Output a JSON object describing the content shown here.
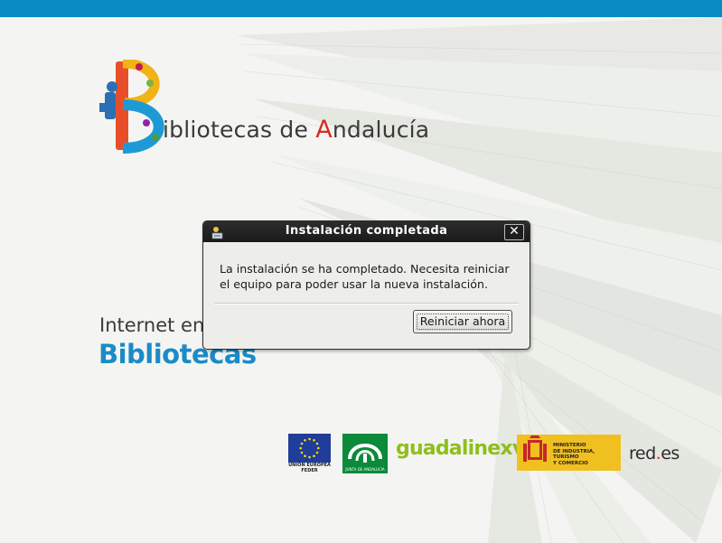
{
  "brand": {
    "logo_text_initial": "B",
    "logo_text_rest": "ibliotecas de ",
    "logo_text_a": "A",
    "logo_text_end": "ndalucía",
    "internet_line1": "Internet en",
    "internet_line2": "Bibliotecas"
  },
  "dialog": {
    "title": "Instalación completada",
    "close_label": "✕",
    "message": "La instalación se ha completado. Necesita reiniciar el equipo para poder usar la nueva instalación.",
    "reboot_label": "Reiniciar ahora"
  },
  "footer": {
    "eu_text": "UNIÓN EUROPEA FEDER",
    "junta_text": "JUNTA DE ANDALUCIA",
    "guadalinex_text": "guadalinex",
    "guadalinex_version": "v5",
    "ministerio_line1": "MINISTERIO",
    "ministerio_line2": "DE INDUSTRIA, TURISMO",
    "ministerio_line3": "Y COMERCIO",
    "redes_text_a": "red",
    "redes_text_dot": ".",
    "redes_text_b": "es"
  },
  "colors": {
    "topbar": "#0b8bc4",
    "dialog_bg": "#ededea",
    "titlebar": "#1e1e1e",
    "accent_blue": "#1a8bc8",
    "accent_red": "#d62a20"
  },
  "icons": {
    "title_icon": "installer-icon",
    "close_icon": "close-icon"
  }
}
